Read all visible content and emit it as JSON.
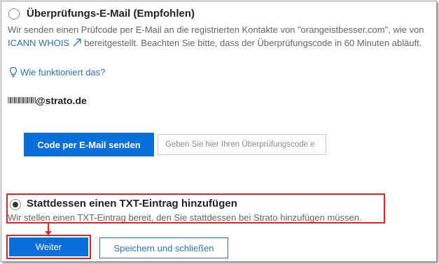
{
  "email_option": {
    "title": "Überprüfungs-E-Mail (Empfohlen)",
    "desc_part1": "Wir senden einen Prüfcode per E-Mail an die registrierten Kontakte von \"orangeistbesser.com\", wie von ",
    "icann_link": "ICANN WHOIS",
    "desc_part2": " bereitgestellt. Beachten Sie bitte, dass der Überprüfungscode in 60 Minuten abläuft.",
    "help_link": "Wie funktioniert das?",
    "email_domain": "@strato.de",
    "send_button": "Code per E-Mail senden",
    "code_placeholder": "Geben Sie hier Ihren Überprüfungscode e"
  },
  "txt_option": {
    "title": "Stattdessen einen TXT-Eintrag hinzufügen",
    "desc": "Wir stellen einen TXT-Eintrag bereit, den Sie stattdessen bei Strato hinzufügen müssen.",
    "selected": true
  },
  "footer": {
    "next_button": "Weiter",
    "save_close_button": "Speichern und schließen"
  },
  "colors": {
    "primary_blue": "#0a6fd8",
    "link_blue": "#2a72b8",
    "highlight_red": "#d8282f"
  }
}
